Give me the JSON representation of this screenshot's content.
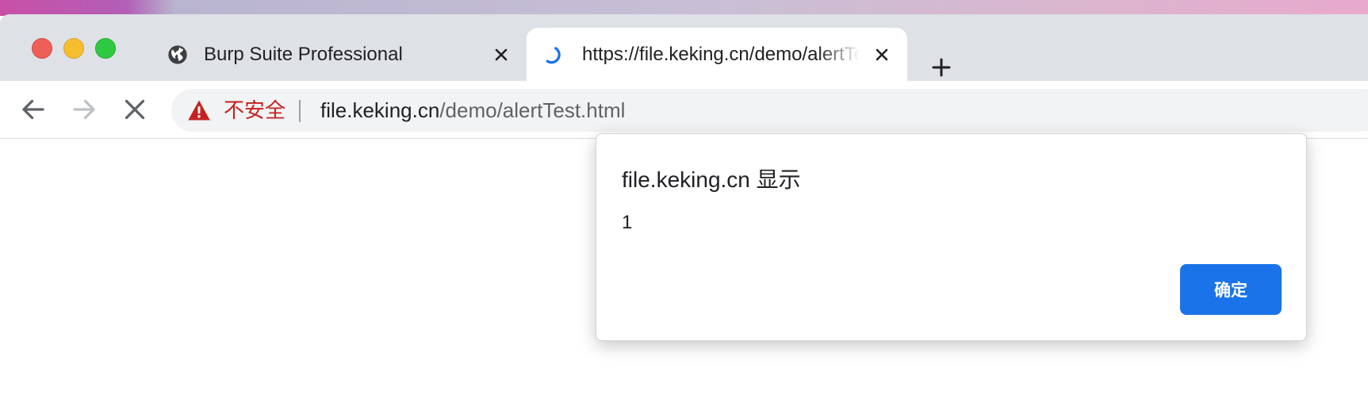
{
  "window": {
    "controls": [
      "close",
      "minimize",
      "zoom"
    ],
    "accent_colors": {
      "close": "#ee5f57",
      "minimize": "#f6be2f",
      "zoom": "#2eca41",
      "primary": "#1a73e8",
      "danger": "#c5221f"
    }
  },
  "tabs": [
    {
      "title": "Burp Suite Professional",
      "icon": "globe-icon",
      "active": false
    },
    {
      "title": "https://file.keking.cn/demo/alertTest.html",
      "icon": "loading-spinner-icon",
      "active": true
    }
  ],
  "toolbar": {
    "back_icon": "arrow-left-icon",
    "forward_icon": "arrow-right-icon",
    "stop_icon": "close-icon",
    "new_tab_icon": "plus-icon"
  },
  "address_bar": {
    "security_icon": "warning-triangle-icon",
    "security_label": "不安全",
    "url_host": "file.keking.cn",
    "url_path": "/demo/alertTest.html"
  },
  "dialog": {
    "title": "file.keking.cn 显示",
    "message": "1",
    "ok_label": "确定"
  }
}
